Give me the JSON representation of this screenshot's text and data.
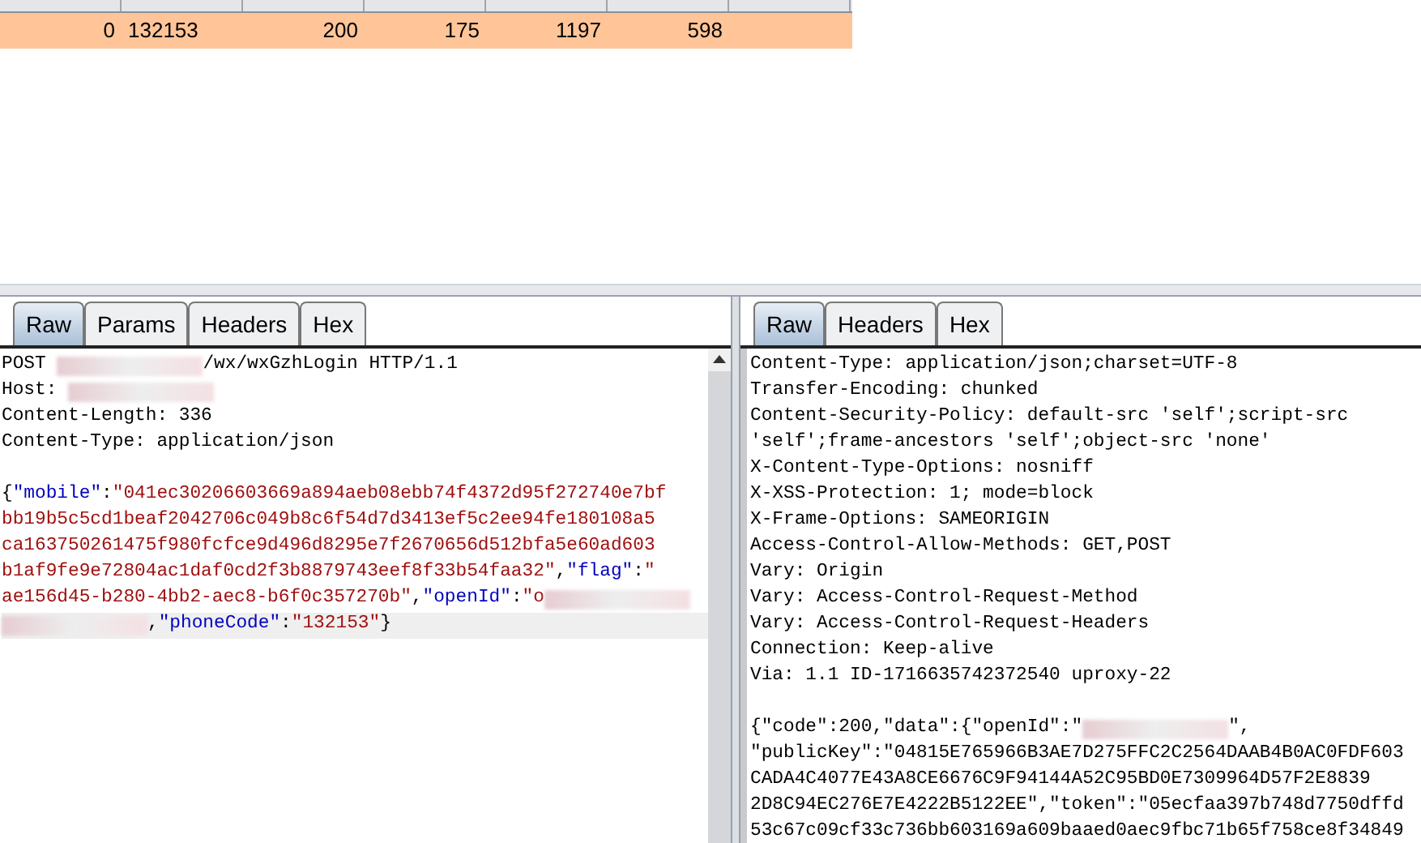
{
  "results_table": {
    "rows": [
      {
        "selected": true,
        "cells": [
          "0",
          "132153",
          "200",
          "175",
          "1197",
          "598",
          ""
        ]
      }
    ]
  },
  "request_pane": {
    "tabs": [
      {
        "label": "Raw",
        "selected": true
      },
      {
        "label": "Params",
        "selected": false
      },
      {
        "label": "Headers",
        "selected": false
      },
      {
        "label": "Hex",
        "selected": false
      }
    ],
    "lines": [
      {
        "current": false,
        "segments": [
          {
            "kind": "plain",
            "text": "POST "
          },
          {
            "kind": "redacted"
          },
          {
            "kind": "plain",
            "text": "/wx/wxGzhLogin HTTP/1.1"
          }
        ]
      },
      {
        "current": false,
        "segments": [
          {
            "kind": "plain",
            "text": "Host: "
          },
          {
            "kind": "redacted"
          }
        ]
      },
      {
        "current": false,
        "segments": [
          {
            "kind": "plain",
            "text": "Content-Length: 336"
          }
        ]
      },
      {
        "current": false,
        "segments": [
          {
            "kind": "plain",
            "text": "Content-Type: application/json"
          }
        ]
      },
      {
        "current": false,
        "blank_line_before": true,
        "segments": [
          {
            "kind": "plain",
            "text": "{"
          },
          {
            "kind": "key",
            "text": "\"mobile\""
          },
          {
            "kind": "plain",
            "text": ":"
          },
          {
            "kind": "string",
            "text": "\"041ec30206603669a894aeb08ebb74f4372d95f272740e7bf"
          }
        ]
      },
      {
        "current": false,
        "segments": [
          {
            "kind": "string",
            "text": "bb19b5c5cd1beaf2042706c049b8c6f54d7d3413ef5c2ee94fe180108a5"
          }
        ]
      },
      {
        "current": false,
        "segments": [
          {
            "kind": "string",
            "text": "ca163750261475f980fcfce9d496d8295e7f2670656d512bfa5e60ad603"
          }
        ]
      },
      {
        "current": false,
        "segments": [
          {
            "kind": "string",
            "text": "b1af9fe9e72804ac1daf0cd2f3b8879743eef8f33b54faa32\""
          },
          {
            "kind": "plain",
            "text": ","
          },
          {
            "kind": "key",
            "text": "\"flag\""
          },
          {
            "kind": "plain",
            "text": ":"
          },
          {
            "kind": "string",
            "text": "\""
          }
        ]
      },
      {
        "current": false,
        "segments": [
          {
            "kind": "string",
            "text": "ae156d45-b280-4bb2-aec8-b6f0c357270b\""
          },
          {
            "kind": "plain",
            "text": ","
          },
          {
            "kind": "key",
            "text": "\"openId\""
          },
          {
            "kind": "plain",
            "text": ":"
          },
          {
            "kind": "string",
            "text": "\"o"
          },
          {
            "kind": "redacted"
          }
        ]
      },
      {
        "current": true,
        "segments": [
          {
            "kind": "redacted"
          },
          {
            "kind": "plain",
            "text": ","
          },
          {
            "kind": "key",
            "text": "\"phoneCode\""
          },
          {
            "kind": "plain",
            "text": ":"
          },
          {
            "kind": "string",
            "text": "\"132153\""
          },
          {
            "kind": "plain",
            "text": "}"
          }
        ]
      }
    ]
  },
  "response_pane": {
    "tabs": [
      {
        "label": "Raw",
        "selected": true
      },
      {
        "label": "Headers",
        "selected": false
      },
      {
        "label": "Hex",
        "selected": false
      }
    ],
    "lines": [
      {
        "current": false,
        "segments": [
          {
            "kind": "plain",
            "text": "Content-Type: application/json;charset=UTF-8"
          }
        ]
      },
      {
        "current": false,
        "segments": [
          {
            "kind": "plain",
            "text": "Transfer-Encoding: chunked"
          }
        ]
      },
      {
        "current": false,
        "segments": [
          {
            "kind": "plain",
            "text": "Content-Security-Policy: default-src 'self';script-src"
          }
        ]
      },
      {
        "current": false,
        "segments": [
          {
            "kind": "plain",
            "text": "'self';frame-ancestors 'self';object-src 'none'"
          }
        ]
      },
      {
        "current": false,
        "segments": [
          {
            "kind": "plain",
            "text": "X-Content-Type-Options: nosniff"
          }
        ]
      },
      {
        "current": false,
        "segments": [
          {
            "kind": "plain",
            "text": "X-XSS-Protection: 1; mode=block"
          }
        ]
      },
      {
        "current": false,
        "segments": [
          {
            "kind": "plain",
            "text": "X-Frame-Options: SAMEORIGIN"
          }
        ]
      },
      {
        "current": false,
        "segments": [
          {
            "kind": "plain",
            "text": "Access-Control-Allow-Methods: GET,POST"
          }
        ]
      },
      {
        "current": false,
        "segments": [
          {
            "kind": "plain",
            "text": "Vary: Origin"
          }
        ]
      },
      {
        "current": false,
        "segments": [
          {
            "kind": "plain",
            "text": "Vary: Access-Control-Request-Method"
          }
        ]
      },
      {
        "current": false,
        "segments": [
          {
            "kind": "plain",
            "text": "Vary: Access-Control-Request-Headers"
          }
        ]
      },
      {
        "current": false,
        "segments": [
          {
            "kind": "plain",
            "text": "Connection: Keep-alive"
          }
        ]
      },
      {
        "current": false,
        "segments": [
          {
            "kind": "plain",
            "text": "Via: 1.1 ID-1716635742372540 uproxy-22"
          }
        ]
      },
      {
        "current": false,
        "blank_line_before": true,
        "segments": [
          {
            "kind": "plain",
            "text": "{\"code\":200,\"data\":{\"openId\":\""
          },
          {
            "kind": "redacted"
          },
          {
            "kind": "plain",
            "text": "\","
          }
        ]
      },
      {
        "current": false,
        "segments": [
          {
            "kind": "plain",
            "text": "\"publicKey\":\"04815E765966B3AE7D275FFC2C2564DAAB4B0AC0FDF603"
          }
        ]
      },
      {
        "current": false,
        "segments": [
          {
            "kind": "plain",
            "text": "CADA4C4077E43A8CE6676C9F94144A52C95BD0E7309964D57F2E8839"
          }
        ]
      },
      {
        "current": false,
        "segments": [
          {
            "kind": "plain",
            "text": "2D8C94EC276E7E4222B5122EE\",\"token\":\"05ecfaa397b748d7750dffd"
          }
        ]
      },
      {
        "current": false,
        "segments": [
          {
            "kind": "plain",
            "text": "53c67c09cf33c736bb603169a609baaed0aec9fbc71b65f758ce8f34849"
          }
        ]
      }
    ]
  }
}
